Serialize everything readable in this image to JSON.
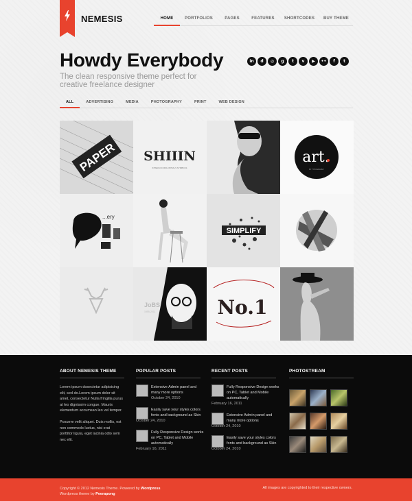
{
  "brand": {
    "name": "NEMESIS",
    "accent": "#e8432e"
  },
  "nav": {
    "items": [
      {
        "label": "HOME",
        "active": true
      },
      {
        "label": "PORTFOLIOS",
        "active": false
      },
      {
        "label": "PAGES",
        "active": false
      },
      {
        "label": "FEATURES",
        "active": false
      },
      {
        "label": "SHORTCODES",
        "active": false
      },
      {
        "label": "BUY THEME",
        "active": false
      }
    ]
  },
  "hero": {
    "title": "Howdy Everybody",
    "subtitle": "The clean responsive theme perfect for creative freelance designer"
  },
  "socials": [
    {
      "icon": "linkedin-icon",
      "glyph": "in"
    },
    {
      "icon": "delicious-icon",
      "glyph": "d"
    },
    {
      "icon": "dribbble-icon",
      "glyph": "◎"
    },
    {
      "icon": "google-plus-icon",
      "glyph": "g"
    },
    {
      "icon": "tumblr-icon",
      "glyph": "t"
    },
    {
      "icon": "vimeo-icon",
      "glyph": "v"
    },
    {
      "icon": "youtube-icon",
      "glyph": "▶"
    },
    {
      "icon": "flickr-icon",
      "glyph": "••"
    },
    {
      "icon": "facebook-icon",
      "glyph": "f"
    },
    {
      "icon": "twitter-icon",
      "glyph": "t"
    }
  ],
  "filters": [
    {
      "label": "ALL",
      "active": true
    },
    {
      "label": "ADVERTISING",
      "active": false
    },
    {
      "label": "MEDIA",
      "active": false
    },
    {
      "label": "PHOTOGRAPHY",
      "active": false
    },
    {
      "label": "PRINT",
      "active": false
    },
    {
      "label": "WEB DESIGN",
      "active": false
    }
  ],
  "portfolio": {
    "tiles": [
      {
        "name": "paper-typography-tile",
        "text": "PAPER"
      },
      {
        "name": "interlocking-type-tile",
        "text": "SHIIIN",
        "caption": "INTERLOCKING INITIALS SYMBOLS"
      },
      {
        "name": "sunglasses-woman-tile",
        "text": ""
      },
      {
        "name": "art-typography-tile",
        "text": "art.",
        "caption": "BY TYPOGRAPHY"
      },
      {
        "name": "speech-bubble-tile",
        "text": "...ery"
      },
      {
        "name": "stool-model-tile",
        "text": ""
      },
      {
        "name": "simplify-tile",
        "text": "SIMPLIFY"
      },
      {
        "name": "abstract-sphere-tile",
        "text": ""
      },
      {
        "name": "deer-logo-tile",
        "text": ""
      },
      {
        "name": "portrait-illustration-tile",
        "text": "JoBS",
        "caption": "1955-2011"
      },
      {
        "name": "no1-typography-tile",
        "text": "No.1"
      },
      {
        "name": "hat-model-tile",
        "text": ""
      }
    ]
  },
  "footer": {
    "about": {
      "heading": "ABOUT NEMESIS THEME",
      "p1": "Lorem ipsum dosectetur adipisicing elit, sed do.Lorem ipsum dolor sit amet, consectetur Nulla fringilla purus at leo dignissim congue. Mauris elementum accumsan leo vel tempor.",
      "p2": "Posuere velit aliquet. Duis mollis, est non commodo luctus, nisi erat porttitor ligula, eget lacinia odio sem nec elit."
    },
    "popular": {
      "heading": "POPULAR POSTS",
      "posts": [
        {
          "title": "Extensive Admin panel and many more options",
          "date": "October 24, 2010"
        },
        {
          "title": "Easily save your styles colors fonts and background as Skin",
          "date": "October 24, 2010"
        },
        {
          "title": "Fully Responsive Design works on PC, Tablet and Mobile automatically",
          "date": "February 16, 2011"
        }
      ]
    },
    "recent": {
      "heading": "RECENT POSTS",
      "posts": [
        {
          "title": "Fully Responsive Design works on PC, Tablet and Mobile automatically",
          "date": "February 16, 2011"
        },
        {
          "title": "Extensive Admin panel and many more options",
          "date": "October 24, 2010"
        },
        {
          "title": "Easily save your styles colors fonts and background as Skin",
          "date": "October 24, 2010"
        }
      ]
    },
    "photostream": {
      "heading": "PHOTOSTREAM"
    }
  },
  "copyright": {
    "line1_prefix": "Copyright © 2012 Nemesis Theme. Powered by ",
    "line1_link": "Wordpress",
    "line2_prefix": "Wordpress theme by ",
    "line2_link": "Peerapong",
    "right": "All images are copyrighted to their respective owners."
  }
}
